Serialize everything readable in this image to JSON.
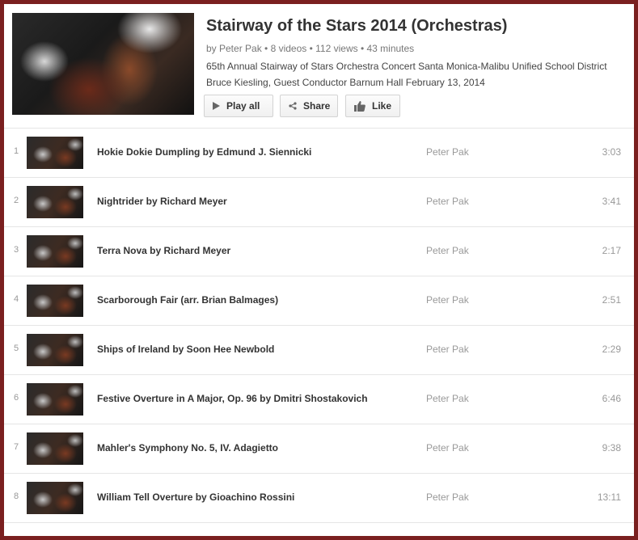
{
  "playlist": {
    "title": "Stairway of the Stars 2014 (Orchestras)",
    "meta": "by Peter Pak • 8 videos • 112 views • 43 minutes",
    "description_line1": "65th Annual Stairway of Stars Orchestra Concert Santa Monica-Malibu Unified School District",
    "description_line2": "Bruce Kiesling, Guest Conductor Barnum Hall February 13, 2014",
    "cover_icon": "orchestra-thumbnail"
  },
  "actions": {
    "play_all": "Play all",
    "share": "Share",
    "like": "Like"
  },
  "videos": [
    {
      "index": "1",
      "title": "Hokie Dokie Dumpling by Edmund J. Siennicki",
      "owner": "Peter Pak",
      "duration": "3:03"
    },
    {
      "index": "2",
      "title": "Nightrider by Richard Meyer",
      "owner": "Peter Pak",
      "duration": "3:41"
    },
    {
      "index": "3",
      "title": "Terra Nova by Richard Meyer",
      "owner": "Peter Pak",
      "duration": "2:17"
    },
    {
      "index": "4",
      "title": "Scarborough Fair (arr. Brian Balmages)",
      "owner": "Peter Pak",
      "duration": "2:51"
    },
    {
      "index": "5",
      "title": "Ships of Ireland by Soon Hee Newbold",
      "owner": "Peter Pak",
      "duration": "2:29"
    },
    {
      "index": "6",
      "title": "Festive Overture in A Major, Op. 96 by Dmitri Shostakovich",
      "owner": "Peter Pak",
      "duration": "6:46"
    },
    {
      "index": "7",
      "title": "Mahler's Symphony No. 5, IV. Adagietto",
      "owner": "Peter Pak",
      "duration": "9:38"
    },
    {
      "index": "8",
      "title": "William Tell Overture by Gioachino Rossini",
      "owner": "Peter Pak",
      "duration": "13:11"
    }
  ],
  "colors": {
    "frame": "#7a1f1f",
    "title": "#333333",
    "muted": "#999999"
  }
}
